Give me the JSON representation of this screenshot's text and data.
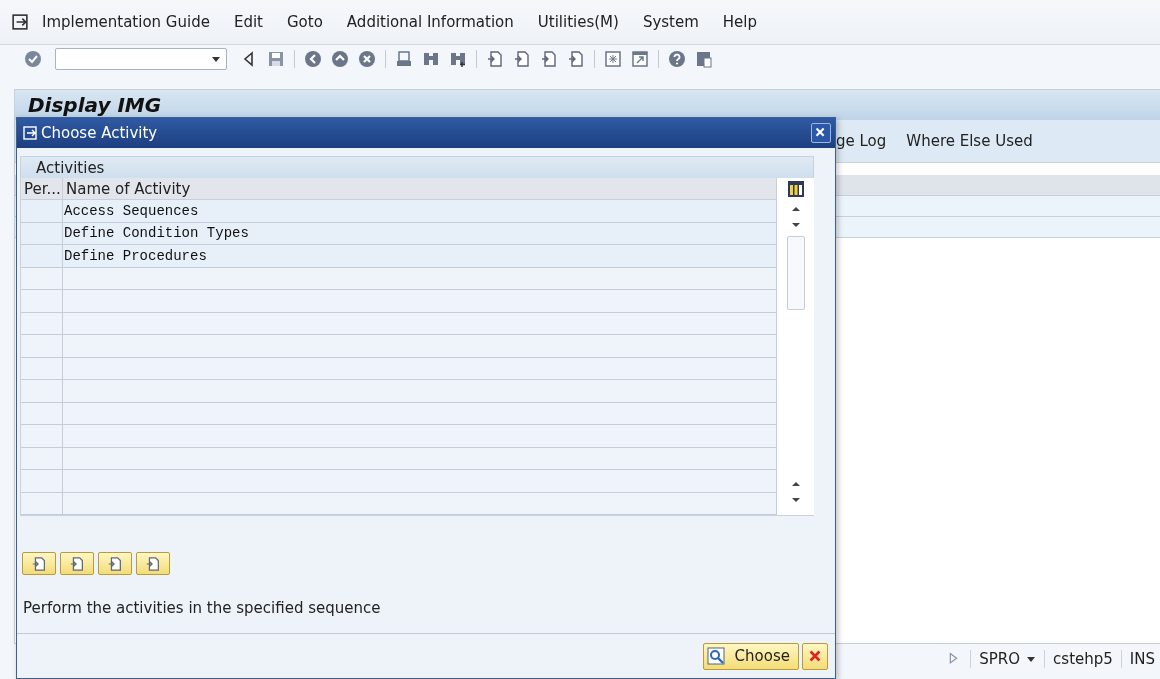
{
  "menu_bar": {
    "items": [
      {
        "label": "Implementation Guide"
      },
      {
        "label": "Edit"
      },
      {
        "label": "Goto"
      },
      {
        "label": "Additional Information"
      },
      {
        "label": "Utilities(M)"
      },
      {
        "label": "System"
      },
      {
        "label": "Help"
      }
    ]
  },
  "screen_title": "Display IMG",
  "app_toolbar": {
    "items": [
      "ge Log",
      "Where Else Used"
    ]
  },
  "dialog": {
    "title": "Choose Activity",
    "group_title": "Activities",
    "columns": [
      "Per...",
      "Name of Activity"
    ],
    "rows": [
      {
        "name": "Access Sequences"
      },
      {
        "name": "Define Condition Types"
      },
      {
        "name": "Define Procedures"
      }
    ],
    "hint": "Perform the activities in the specified sequence",
    "choose_button": "Choose"
  },
  "status_bar": {
    "transaction": "SPRO",
    "user": "cstehp5",
    "mode": "INS"
  }
}
